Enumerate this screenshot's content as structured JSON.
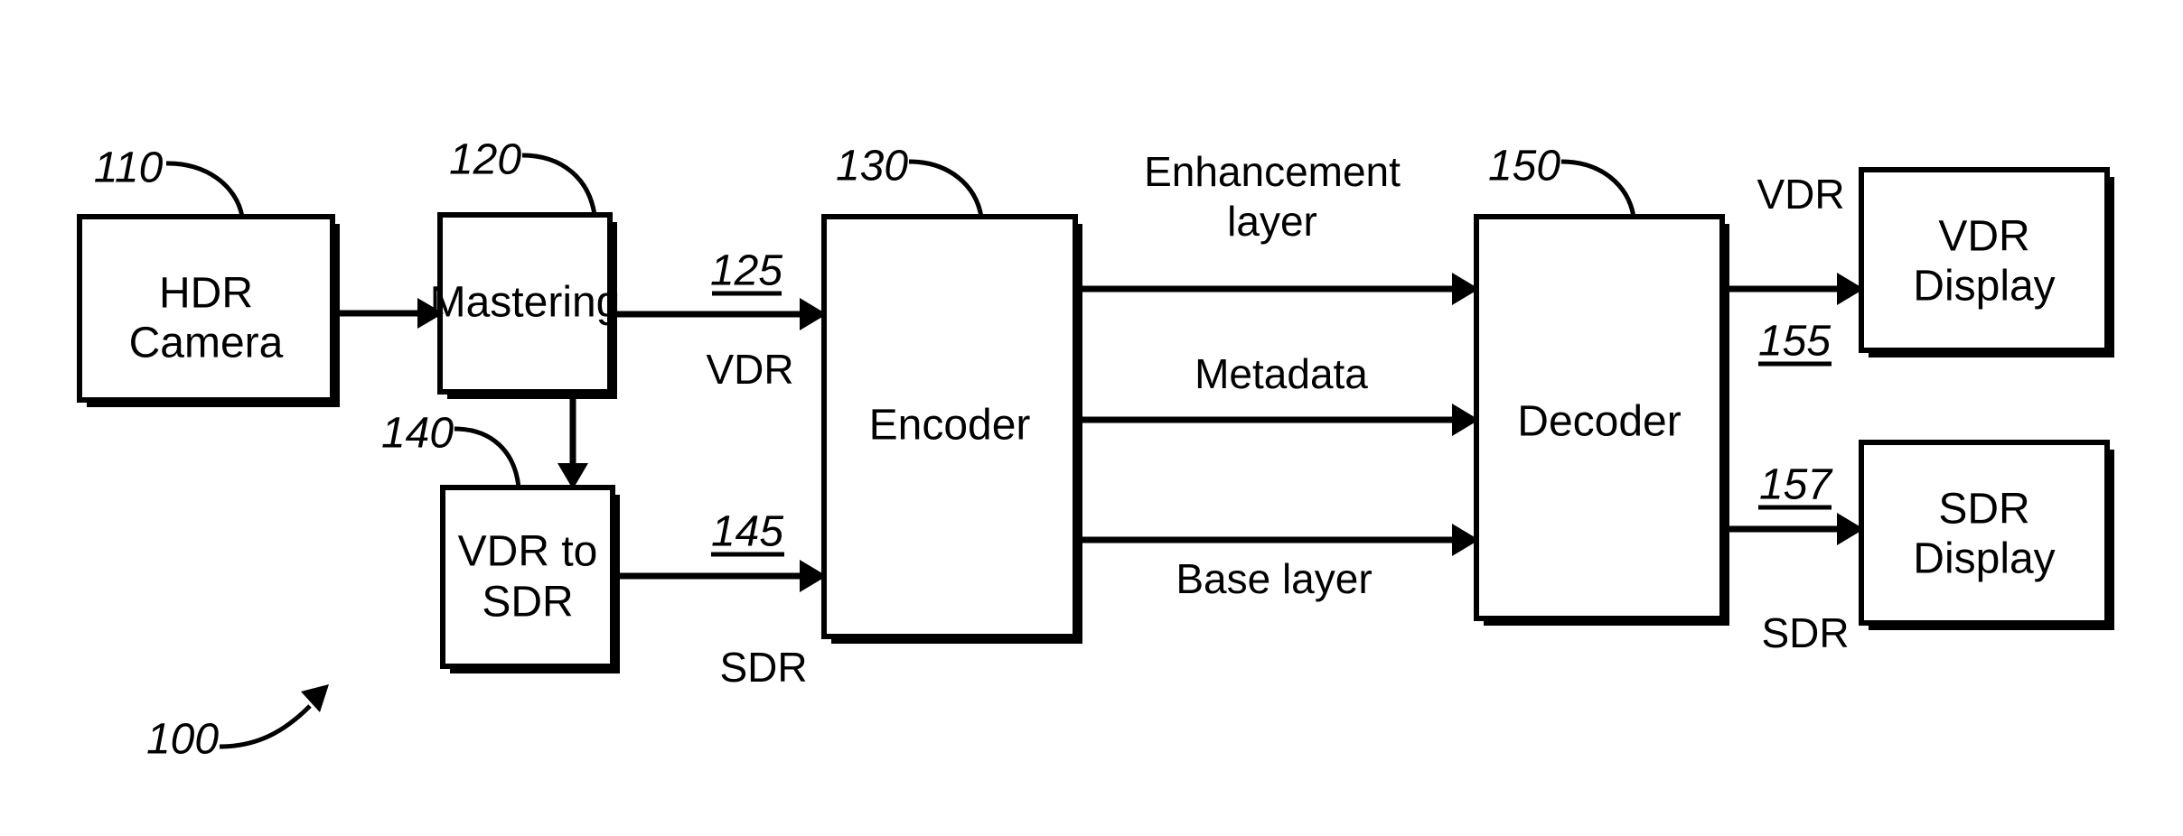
{
  "figure": {
    "figure_ref": "100",
    "background_color": "#ffffff",
    "line_color": "#000000"
  },
  "blocks": [
    {
      "id": "hdr_camera",
      "label_line1": "HDR",
      "label_line2": "Camera",
      "ref": "110"
    },
    {
      "id": "mastering",
      "label_line1": "Mastering",
      "label_line2": "",
      "ref": "120"
    },
    {
      "id": "vdr_to_sdr",
      "label_line1": "VDR to",
      "label_line2": "SDR",
      "ref": "140"
    },
    {
      "id": "encoder",
      "label_line1": "Encoder",
      "label_line2": "",
      "ref": "130"
    },
    {
      "id": "decoder",
      "label_line1": "Decoder",
      "label_line2": "",
      "ref": "150"
    },
    {
      "id": "vdr_display",
      "label_line1": "VDR",
      "label_line2": "Display",
      "ref": ""
    },
    {
      "id": "sdr_display",
      "label_line1": "SDR",
      "label_line2": "Display",
      "ref": ""
    }
  ],
  "signals": {
    "mastering_to_encoder_ref": "125",
    "mastering_to_encoder_format": "VDR",
    "vdrsdr_to_encoder_ref": "145",
    "vdrsdr_to_encoder_format": "SDR",
    "enhancement_layer_line1": "Enhancement",
    "enhancement_layer_line2": "layer",
    "metadata": "Metadata",
    "base_layer": "Base layer",
    "decoder_to_vdr_format": "VDR",
    "decoder_to_vdr_ref": "155",
    "decoder_to_sdr_ref": "157",
    "decoder_to_sdr_format": "SDR"
  }
}
